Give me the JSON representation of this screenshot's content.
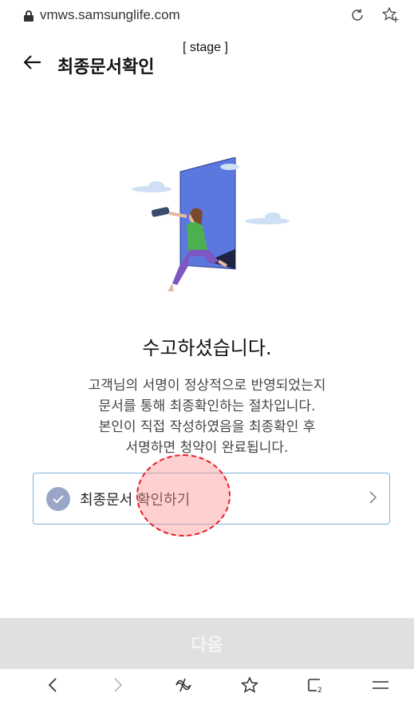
{
  "browser": {
    "url": "vmws.samsunglife.com",
    "icons": [
      "lock-icon",
      "refresh-icon",
      "bookmark-add-icon"
    ]
  },
  "header": {
    "title": "최종문서확인",
    "stage": "[ stage ]"
  },
  "main": {
    "title": "수고하셨습니다.",
    "description_lines": [
      "고객님의 서명이 정상적으로 반영되었는지",
      "문서를 통해 최종확인하는 절차입니다.",
      "본인이 직접 작성하였음을 최종확인 후",
      "서명하면 청약이 완료됩니다."
    ],
    "confirm_button": "최종문서 확인하기"
  },
  "footer": {
    "next_label": "다음"
  },
  "bottom_nav": [
    "back-icon",
    "forward-icon",
    "bixby-icon",
    "bookmark-icon",
    "tabs-icon",
    "menu-icon"
  ],
  "colors": {
    "check_circle": "#9aa6c7",
    "button_border": "#7fb4d6",
    "next_bar": "#e0e0e0",
    "highlight": "#e0202a"
  }
}
